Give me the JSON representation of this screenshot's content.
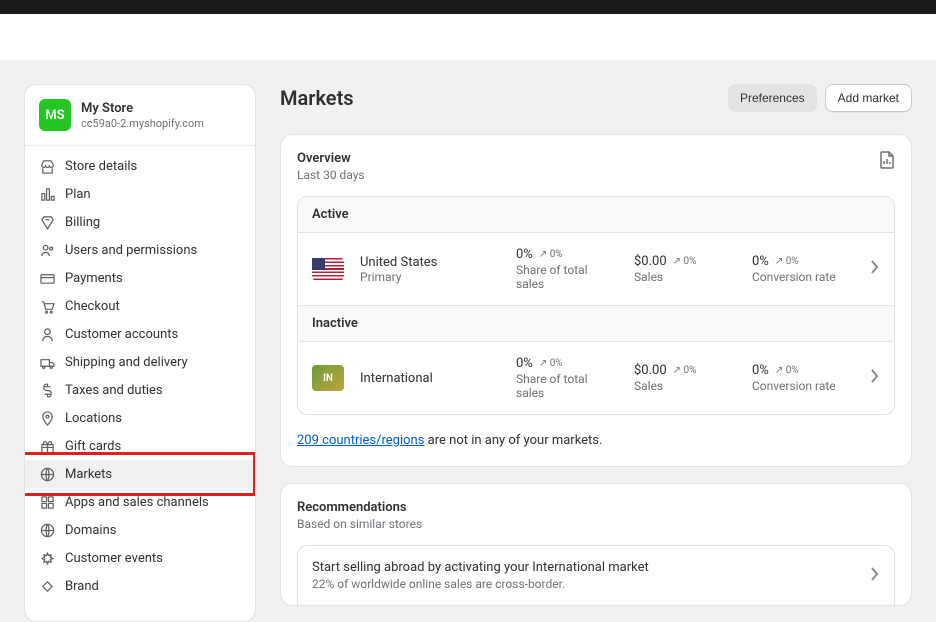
{
  "store": {
    "badge": "MS",
    "name": "My Store",
    "domain": "cc59a0-2.myshopify.com"
  },
  "nav": [
    {
      "label": "Store details",
      "icon": "store"
    },
    {
      "label": "Plan",
      "icon": "plan"
    },
    {
      "label": "Billing",
      "icon": "billing"
    },
    {
      "label": "Users and permissions",
      "icon": "users"
    },
    {
      "label": "Payments",
      "icon": "payments"
    },
    {
      "label": "Checkout",
      "icon": "checkout"
    },
    {
      "label": "Customer accounts",
      "icon": "customer"
    },
    {
      "label": "Shipping and delivery",
      "icon": "shipping"
    },
    {
      "label": "Taxes and duties",
      "icon": "taxes"
    },
    {
      "label": "Locations",
      "icon": "locations"
    },
    {
      "label": "Gift cards",
      "icon": "gift"
    },
    {
      "label": "Markets",
      "icon": "markets",
      "selected": true,
      "highlighted": true
    },
    {
      "label": "Apps and sales channels",
      "icon": "apps"
    },
    {
      "label": "Domains",
      "icon": "domains"
    },
    {
      "label": "Customer events",
      "icon": "events"
    },
    {
      "label": "Brand",
      "icon": "brand"
    }
  ],
  "header": {
    "title": "Markets",
    "preferences": "Preferences",
    "add_market": "Add market"
  },
  "overview": {
    "title": "Overview",
    "sub": "Last 30 days",
    "active_label": "Active",
    "inactive_label": "Inactive",
    "rows": [
      {
        "name": "United States",
        "sub": "Primary",
        "share": "0%",
        "share_change": "↗ 0%",
        "share_label": "Share of total sales",
        "sales": "$0.00",
        "sales_change": "↗ 0%",
        "sales_label": "Sales",
        "conv": "0%",
        "conv_change": "↗ 0%",
        "conv_label": "Conversion rate",
        "flag": "us"
      },
      {
        "name": "International",
        "sub": "",
        "share": "0%",
        "share_change": "↗ 0%",
        "share_label": "Share of total sales",
        "sales": "$0.00",
        "sales_change": "↗ 0%",
        "sales_label": "Sales",
        "conv": "0%",
        "conv_change": "↗ 0%",
        "conv_label": "Conversion rate",
        "flag": "in"
      }
    ],
    "notice_link": "209 countries/regions",
    "notice_rest": " are not in any of your markets."
  },
  "recommendations": {
    "title": "Recommendations",
    "sub": "Based on similar stores",
    "row_title": "Start selling abroad by activating your International market",
    "row_sub": "22% of worldwide online sales are cross-border."
  },
  "intl_badge": "IN"
}
